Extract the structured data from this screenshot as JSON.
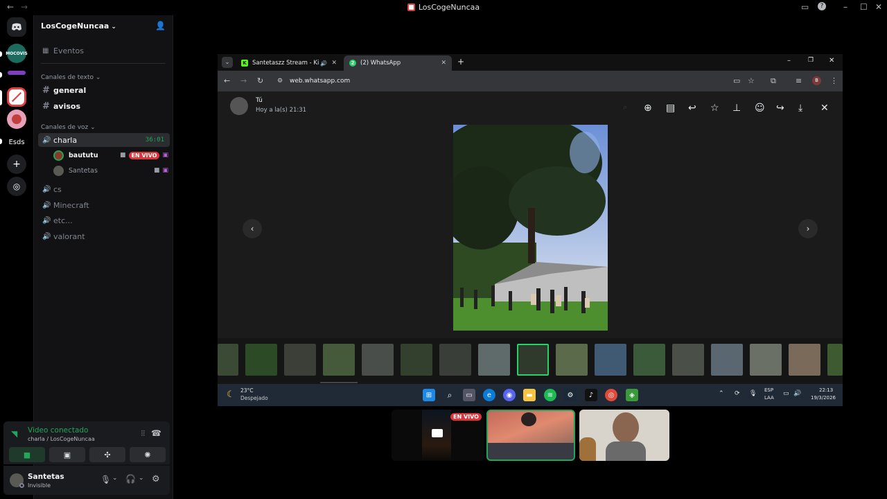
{
  "window": {
    "title": "LosCogeNuncaa"
  },
  "server": {
    "name": "LosCogeNuncaa",
    "events_label": "Eventos"
  },
  "rail": {
    "esds_label": "Esds",
    "mocovis_label": "MOCOVIS"
  },
  "sidebar": {
    "text_category": "Canales de texto",
    "voice_category": "Canales de voz",
    "text_channels": [
      {
        "label": "general"
      },
      {
        "label": "avisos"
      }
    ],
    "active_voice": {
      "label": "charla",
      "timer": "36:01"
    },
    "voice_users": [
      {
        "name": "baututu",
        "live": "EN VIVO"
      },
      {
        "name": "Santetas"
      }
    ],
    "voice_channels": [
      {
        "label": "cs"
      },
      {
        "label": "Minecraft"
      },
      {
        "label": "etc..."
      },
      {
        "label": "valorant"
      }
    ]
  },
  "voice_panel": {
    "status": "Video conectado",
    "location": "charla / LosCogeNuncaa"
  },
  "user_panel": {
    "name": "Santetas",
    "status": "Invisible"
  },
  "browser": {
    "tabs": [
      {
        "label": "Santetaszz Stream - Kick Da"
      },
      {
        "label": "(2) WhatsApp",
        "badge": "2"
      }
    ],
    "url": "web.whatsapp.com"
  },
  "whatsapp": {
    "sender": "Tú",
    "time": "Hoy a la(s) 21:31"
  },
  "taskbar": {
    "weather_temp": "23°C",
    "weather_desc": "Despejado",
    "lang_top": "ESP",
    "lang_bottom": "LAA",
    "time": "22:13",
    "date": "19/3/2026"
  },
  "stream": {
    "live_label": "EN VIVO"
  },
  "colors": {
    "accent_green": "#23a55a",
    "live_red": "#da373c",
    "whatsapp_green": "#25d366"
  }
}
